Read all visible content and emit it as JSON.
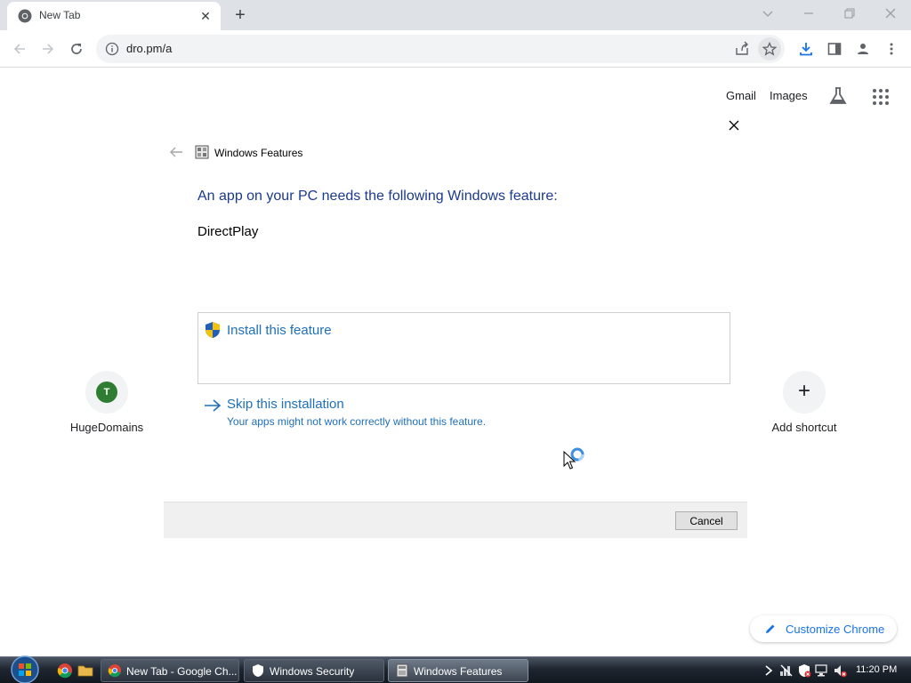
{
  "browser": {
    "tab_title": "New Tab",
    "url": "dro.pm/a"
  },
  "ntp": {
    "links": {
      "gmail": "Gmail",
      "images": "Images"
    },
    "shortcuts": [
      {
        "label": "HugeDomains",
        "initial": "T"
      },
      {
        "label": "Add shortcut"
      }
    ],
    "customize_label": "Customize Chrome"
  },
  "dialog": {
    "window_title": "Windows Features",
    "heading": "An app on your PC needs the following Windows feature:",
    "feature_name": "DirectPlay",
    "install_label": "Install this feature",
    "skip_label": "Skip this installation",
    "skip_sublabel": "Your apps might not work correctly without this feature.",
    "cancel_label": "Cancel"
  },
  "taskbar": {
    "items": [
      {
        "label": "New Tab - Google Ch..."
      },
      {
        "label": "Windows Security"
      },
      {
        "label": "Windows Features"
      }
    ],
    "clock": "11:20 PM"
  },
  "colors": {
    "dialog_heading": "#1c3a8c",
    "dialog_link": "#1f6fb7",
    "chrome_accent": "#1a73e8",
    "avatar_green": "#2e7d32"
  }
}
